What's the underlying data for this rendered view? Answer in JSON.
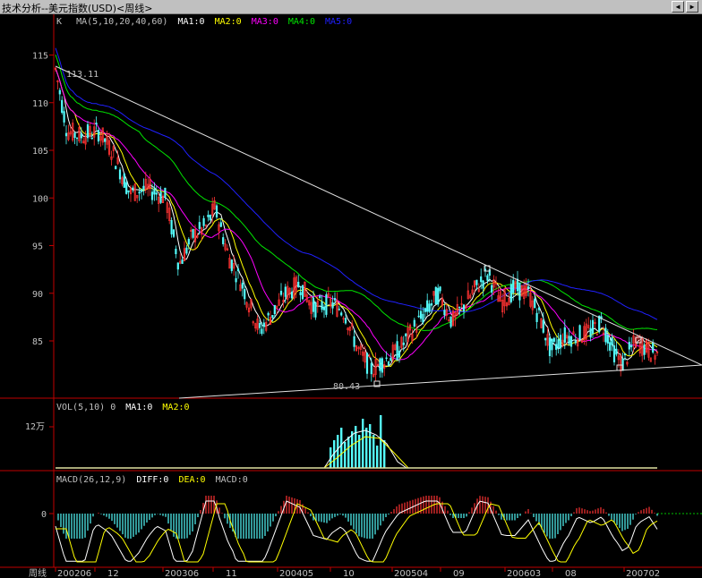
{
  "window": {
    "title": "技术分析--美元指数(USD)<周线>",
    "btn_left": "◀",
    "btn_right": "▶"
  },
  "colors": {
    "up": "#ff3232",
    "down": "#54fcfc",
    "ma1": "#ffffff",
    "ma2": "#ffff00",
    "ma3": "#ff00ff",
    "ma4": "#00e600",
    "ma5": "#2020ff",
    "divider": "#c00000",
    "trendline": "#e0e0e0"
  },
  "main_header": {
    "k": "K",
    "ma": "MA(5,10,20,40,60)",
    "ma1": "MA1:0",
    "ma2": "MA2:0",
    "ma3": "MA3:0",
    "ma4": "MA4:0",
    "ma5": "MA5:0"
  },
  "vol_header": {
    "vol": "VOL(5,10) 0",
    "ma1": "MA1:0",
    "ma2": "MA2:0"
  },
  "macd_header": {
    "macd": "MACD(26,12,9)",
    "diff": "DIFF:0",
    "dea": "DEA:0",
    "macdv": "MACD:0"
  },
  "period_label": "周线",
  "chart_data": {
    "type": "candlestick",
    "main_yaxis": {
      "ticks": [
        115,
        110,
        105,
        100,
        95,
        90,
        85
      ],
      "range": [
        80,
        117
      ]
    },
    "vol_yaxis": {
      "ticks": [
        "12万"
      ]
    },
    "macd_yaxis": {
      "ticks": [
        "0"
      ]
    },
    "x_ticks": [
      "200206",
      "12",
      "200306",
      "11",
      "200405",
      "10",
      "200504",
      "09",
      "200603",
      "08",
      "200702"
    ],
    "annotations": [
      {
        "label": "113.11",
        "value": 113.11
      },
      {
        "label": "80.43",
        "value": 80.43
      }
    ]
  }
}
